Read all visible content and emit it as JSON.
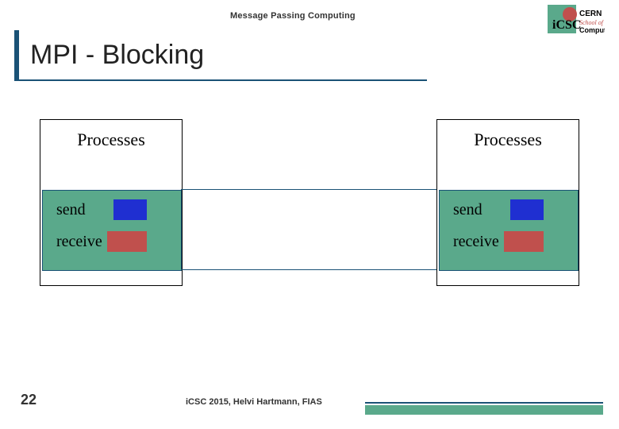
{
  "header": {
    "subject": "Message Passing Computing"
  },
  "logo": {
    "initials": "iCSC",
    "org": "CERN",
    "tagline_a": "School of",
    "tagline_b": "Computing"
  },
  "title": "MPI - Blocking",
  "diagram": {
    "left": {
      "label": "Processes",
      "op1": "send",
      "op2": "receive"
    },
    "right": {
      "label": "Processes",
      "op1": "send",
      "op2": "receive"
    }
  },
  "footer": {
    "slide_number": "22",
    "attribution": "iCSC 2015, Helvi Hartmann, FIAS"
  }
}
